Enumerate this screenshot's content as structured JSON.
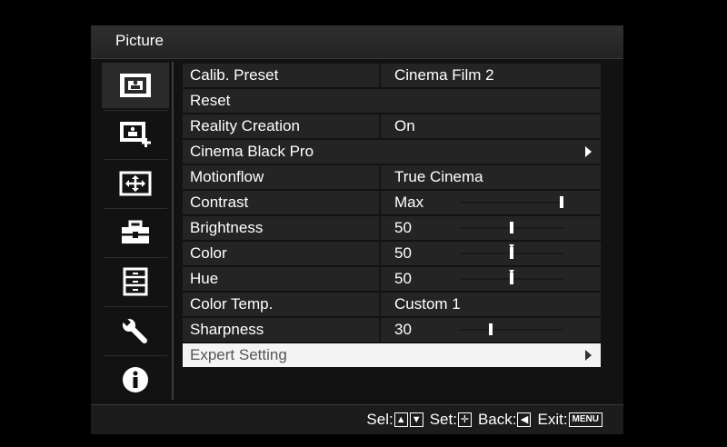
{
  "menu": {
    "title": "Picture"
  },
  "sidebar": {
    "items": [
      {
        "name": "picture-icon",
        "selected": true
      },
      {
        "name": "picture-add-icon",
        "selected": false
      },
      {
        "name": "screen-icon",
        "selected": false
      },
      {
        "name": "toolbox-icon",
        "selected": false
      },
      {
        "name": "cabinet-icon",
        "selected": false
      },
      {
        "name": "wrench-icon",
        "selected": false
      },
      {
        "name": "info-icon",
        "selected": false
      }
    ]
  },
  "settings": {
    "rows": [
      {
        "label": "Calib. Preset",
        "value": "Cinema Film 2"
      },
      {
        "label": "Reset"
      },
      {
        "label": "Reality Creation",
        "value": "On"
      },
      {
        "label": "Cinema Black Pro",
        "submenu": true
      },
      {
        "label": "Motionflow",
        "value": "True Cinema"
      },
      {
        "label": "Contrast",
        "value": "Max",
        "slider": 1.0
      },
      {
        "label": "Brightness",
        "value": "50",
        "slider": 0.5
      },
      {
        "label": "Color",
        "value": "50",
        "slider": 0.5,
        "center_mark": true
      },
      {
        "label": "Hue",
        "value": "50",
        "slider": 0.5,
        "center_mark": true
      },
      {
        "label": "Color Temp.",
        "value": "Custom 1"
      },
      {
        "label": "Sharpness",
        "value": "30",
        "slider": 0.3
      },
      {
        "label": "Expert Setting",
        "submenu": true,
        "selected": true
      }
    ]
  },
  "footer": {
    "sel": "Sel:",
    "set": "Set:",
    "back": "Back:",
    "exit": "Exit:",
    "menu_key": "MENU"
  }
}
